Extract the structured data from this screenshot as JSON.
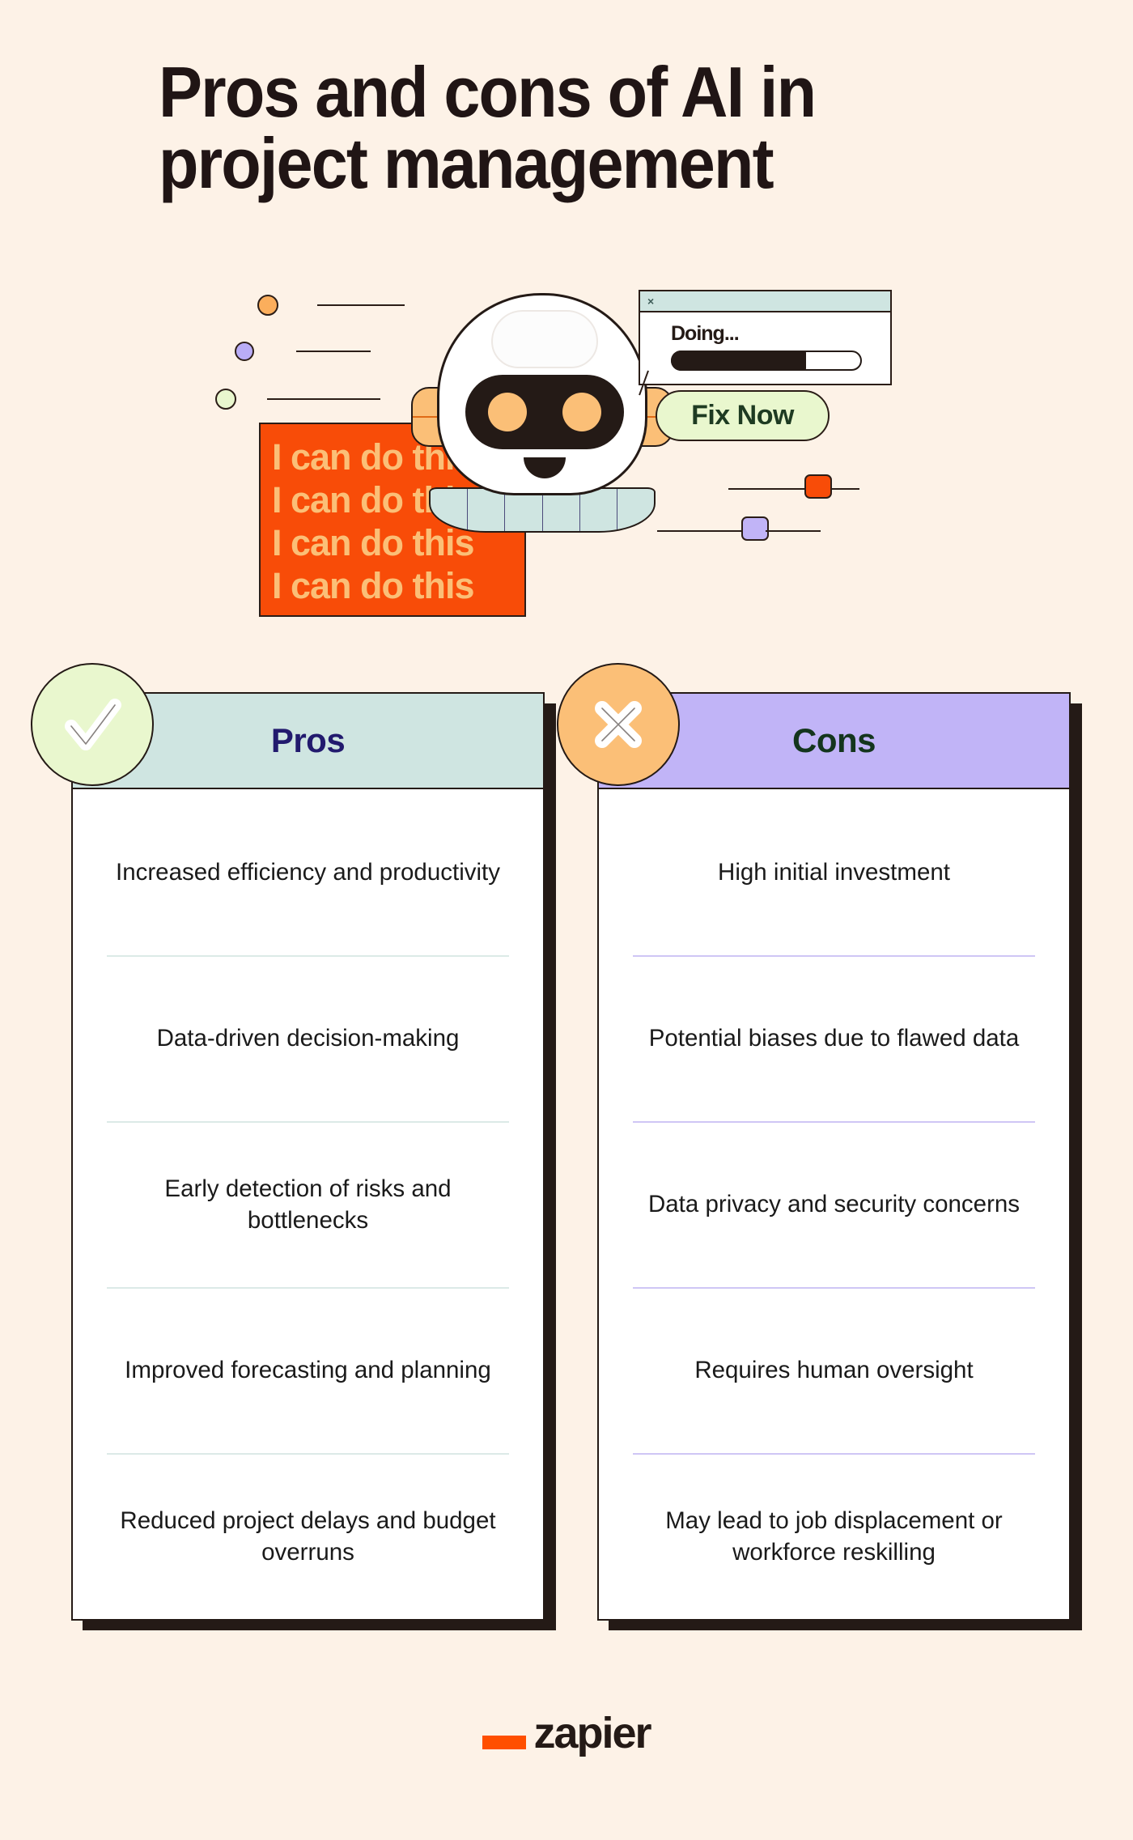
{
  "colors": {
    "background": "#FDF2E7",
    "ink": "#241A16",
    "pros_header": "#CFE5E1",
    "cons_header": "#C1B4F7",
    "pros_badge": "#E9F7CE",
    "cons_badge": "#FBBF77",
    "pros_title_text": "#221A6E",
    "cons_title_text": "#14351D",
    "orange_block": "#F84C08",
    "orange_text": "#FBBF77",
    "fixnow_bg": "#E9F7CE",
    "fixnow_text": "#1E3B22",
    "brand_orange": "#FF4F00"
  },
  "title": {
    "line1": "Pros and cons of AI in",
    "line2": "project management"
  },
  "illustration": {
    "orange_block_lines": [
      "I can do this",
      "I can do this",
      "I can do this",
      "I can do this"
    ],
    "window": {
      "close_label": "×",
      "status_text": "Doing...",
      "progress_percent": "72"
    },
    "fix_now_button": "Fix Now",
    "dots": [
      {
        "name": "orange-dot",
        "color": "#FBAE5C"
      },
      {
        "name": "purple-dot",
        "color": "#B9ADF7"
      },
      {
        "name": "green-dot",
        "color": "#E9F7CE"
      }
    ],
    "squares": [
      {
        "name": "orange-square",
        "color": "#F84C08"
      },
      {
        "name": "purple-square",
        "color": "#C1B4F7"
      }
    ],
    "robot": {
      "eye_color": "#FBBF77",
      "visor_color": "#241A16",
      "collar_color": "#CFE5E1",
      "neck_segments": 6
    }
  },
  "cards": [
    {
      "id": "pros",
      "title": "Pros",
      "badge_icon": "check-icon",
      "items": [
        "Increased efficiency and productivity",
        "Data-driven decision-making",
        "Early detection of risks and bottlenecks",
        "Improved forecasting and planning",
        "Reduced project delays and budget overruns"
      ]
    },
    {
      "id": "cons",
      "title": "Cons",
      "badge_icon": "x-icon",
      "items": [
        "High initial investment",
        "Potential biases due to flawed data",
        "Data privacy and security concerns",
        "Requires human oversight",
        "May lead to job displacement or workforce reskilling"
      ]
    }
  ],
  "footer": {
    "brand": "zapier"
  }
}
